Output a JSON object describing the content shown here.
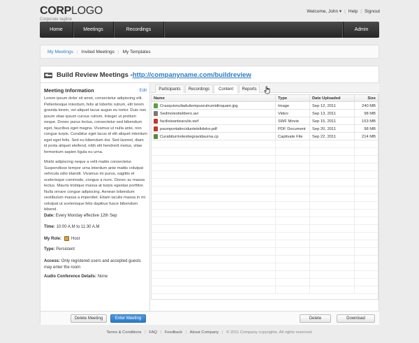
{
  "brand": {
    "logo_bold": "CORP",
    "logo_light": "LOGO",
    "tagline": "Corporate tagline"
  },
  "top_nav": {
    "welcome": "Welcome, John",
    "help": "Help",
    "signout": "Signout"
  },
  "main_nav": {
    "items": [
      "Home",
      "Meetings",
      "Recordings"
    ],
    "admin": "Admin"
  },
  "sub_nav": {
    "items": [
      "My Meetings",
      "Invited Meetings",
      "My Templates"
    ],
    "active": "My Meetings"
  },
  "page": {
    "title": "Build Review Meetings - ",
    "link": "http://companyname.com/buildreview"
  },
  "meeting_info": {
    "heading": "Meeting Information",
    "edit": "Edit",
    "para1": "Lorem ipsum dolor sit amet, consectetur adipiscing elit. Pellentesque interdum, felis at lobortis rutrum, elit lorem gravida lorem, vel aliquet lacus augue eu tortor. Duis non ipsum vitae ipsum cursus rutrum. Integer ut pretium neque. Donec purus lectus, consectetur sed bibendum eget, faucibus eget magna. Vivamus ut nulla ante, non congue turpis. Curabitur eget lacus id elit aliquet interdum eget eget felis. Sed eu bibendum dui. Sed laoreet, diam id porta aliquet eleifend, nibh elit hendrerit metus, vitae fermentum sapien ligula eu urna.",
    "para2": "Morbi adipiscing neque a velit mattis consectetur. Suspendisse tempor urna interdum ante mattis volutpat vehicula odio blandit. Vivamus mi purus, sagittis et scelerisque commodo, congue a nunc. Donec ac massa lectus. Mauris tristique massa at turpis egestas porttitor. Nulla ornare congue adipiscing. Aenean bibendum vestibulum massa a imperdiet. Etiam iaculis massa in mi volutpat ut scelerisque felis dapibus fusce bibendum bibend.",
    "date_label": "Date:",
    "date_value": "Every Monday effective 12th Sep",
    "time_label": "Time:",
    "time_value": "10:00 A.M to 11:30 A.M",
    "role_label": "My Role:",
    "role_value": "Host",
    "type_label": "Type:",
    "type_value": "Persistent",
    "access_label": "Access:",
    "access_value": "Only registered users and accepted guests may enter the room",
    "audio_label": "Audio Conference Details:",
    "audio_value": "None"
  },
  "left_buttons": {
    "delete": "Delete Meeting",
    "enter": "Enter Meeting"
  },
  "tabs": [
    "Participants",
    "Recordings",
    "Content",
    "Reports"
  ],
  "active_tab": "Content",
  "table": {
    "columns": [
      "Name",
      "Type",
      "Date Uploaded",
      "Size"
    ],
    "rows": [
      {
        "name": "Crasquisnulladuitempusrutrumidinquam.jpg",
        "type": "Image",
        "date": "Sep 12, 2011",
        "size": "240 MB",
        "icon_color": "#5aa04a"
      },
      {
        "name": "Sedmolestielibero.avi",
        "type": "Video",
        "date": "Sep 13, 2011",
        "size": "98 MB",
        "icon_color": "#777777"
      },
      {
        "name": "facilisisanteaculis.swf",
        "type": "SWF Movie",
        "date": "Sep 15, 2011",
        "size": "153 MB",
        "icon_color": "#c0392b"
      },
      {
        "name": "psumportatincidunteleltdolor.pdf",
        "type": "PDF Document",
        "date": "Sep 20, 2011",
        "size": "98 MB",
        "icon_color": "#c0392b"
      },
      {
        "name": "Curabiturmolestiegravidaurna.cp",
        "type": "Captivate File",
        "date": "Sep 22, 2011",
        "size": "214 MB",
        "icon_color": "#5a8a3a"
      }
    ]
  },
  "right_buttons": {
    "delete": "Delete",
    "download": "Download"
  },
  "footer": {
    "links": [
      "Terms & Conditions",
      "FAQ",
      "Feedback",
      "About Company"
    ],
    "copyright": "© 2011 Company copyrights. All rights reserved."
  }
}
